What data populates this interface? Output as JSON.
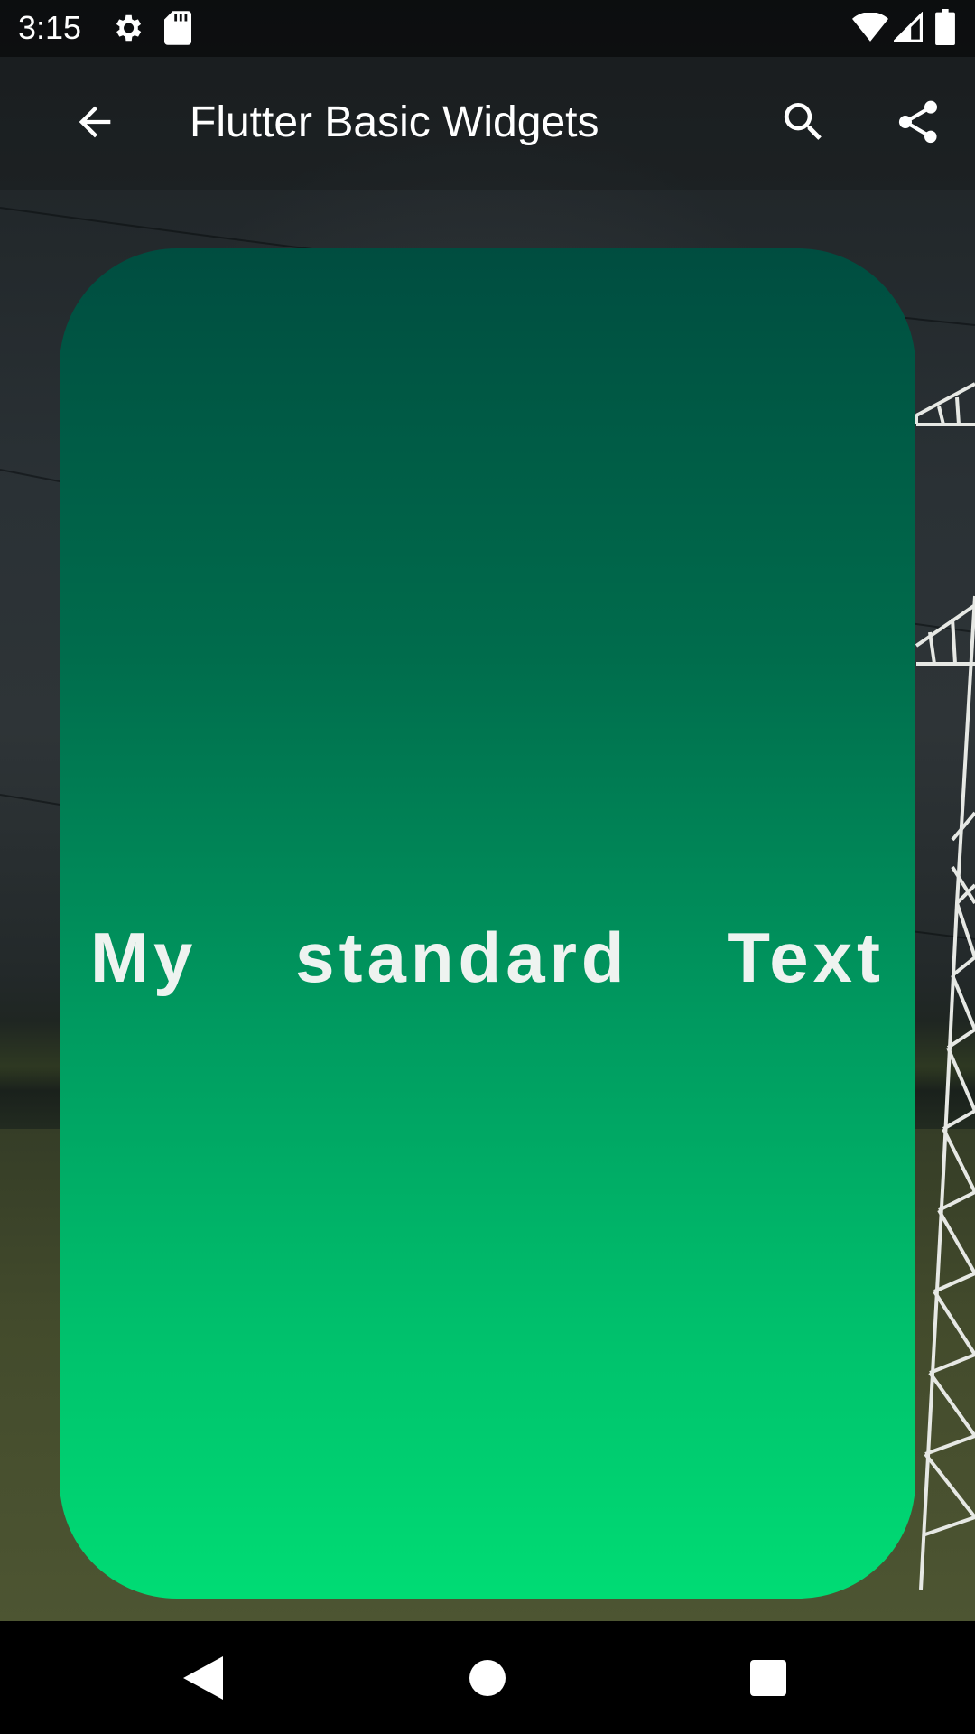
{
  "status_bar": {
    "time": "3:15",
    "icons": [
      "gear-icon",
      "sd-card-icon",
      "wifi-icon",
      "signal-icon",
      "battery-icon"
    ]
  },
  "app_bar": {
    "title": "Flutter Basic Widgets",
    "back_icon": "arrow-left-icon",
    "actions": [
      "search-icon",
      "share-icon"
    ]
  },
  "card": {
    "words": [
      "My",
      "standard",
      "Text"
    ],
    "gradient_top": "#004d40",
    "gradient_bottom": "#00dc74",
    "text_color": "#eef3f0"
  },
  "nav_bar": {
    "buttons": [
      "back-triangle-icon",
      "home-circle-icon",
      "recents-square-icon"
    ]
  }
}
